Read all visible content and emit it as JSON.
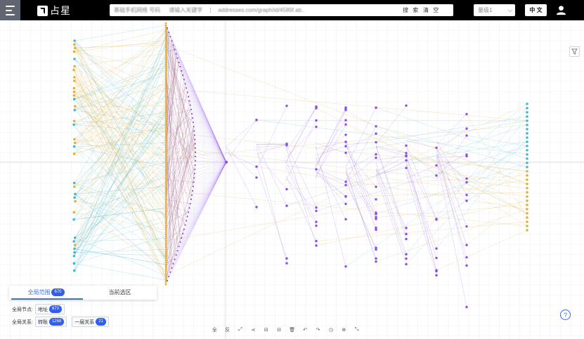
{
  "header": {
    "logo_text": "占星",
    "search": {
      "field1": "基础手机网络 号码",
      "field1_hint": "请输入关键字",
      "field2": "addresses.com/graph/id/4589f.ab..",
      "search_label": "搜 索",
      "clear_label": "清 空"
    },
    "select_value": "量级1",
    "lang_label": "中 文"
  },
  "panel": {
    "tab_all": "全局范围",
    "tab_all_count": "670",
    "tab_selected": "当前选区",
    "nodes_label": "全局节点:",
    "node_type": "地址",
    "node_count": "670",
    "rel_label": "全局关系:",
    "rel_type1": "转账",
    "rel_count1": "1268",
    "rel_type2": "一层关系",
    "rel_count2": "21"
  },
  "toolbar": {
    "items": [
      "全",
      "反",
      "⤢",
      "⋖",
      "⊟",
      "⊟",
      "🗑",
      "↶",
      "↷",
      "◷",
      "⊕",
      "⤡"
    ]
  },
  "help_label": "?",
  "colors": {
    "topbar": "#000000",
    "accent": "#2f5ef0",
    "node_gold": "#e0b03c",
    "node_cyan": "#41b8d0",
    "node_purple": "#8a4de8"
  }
}
